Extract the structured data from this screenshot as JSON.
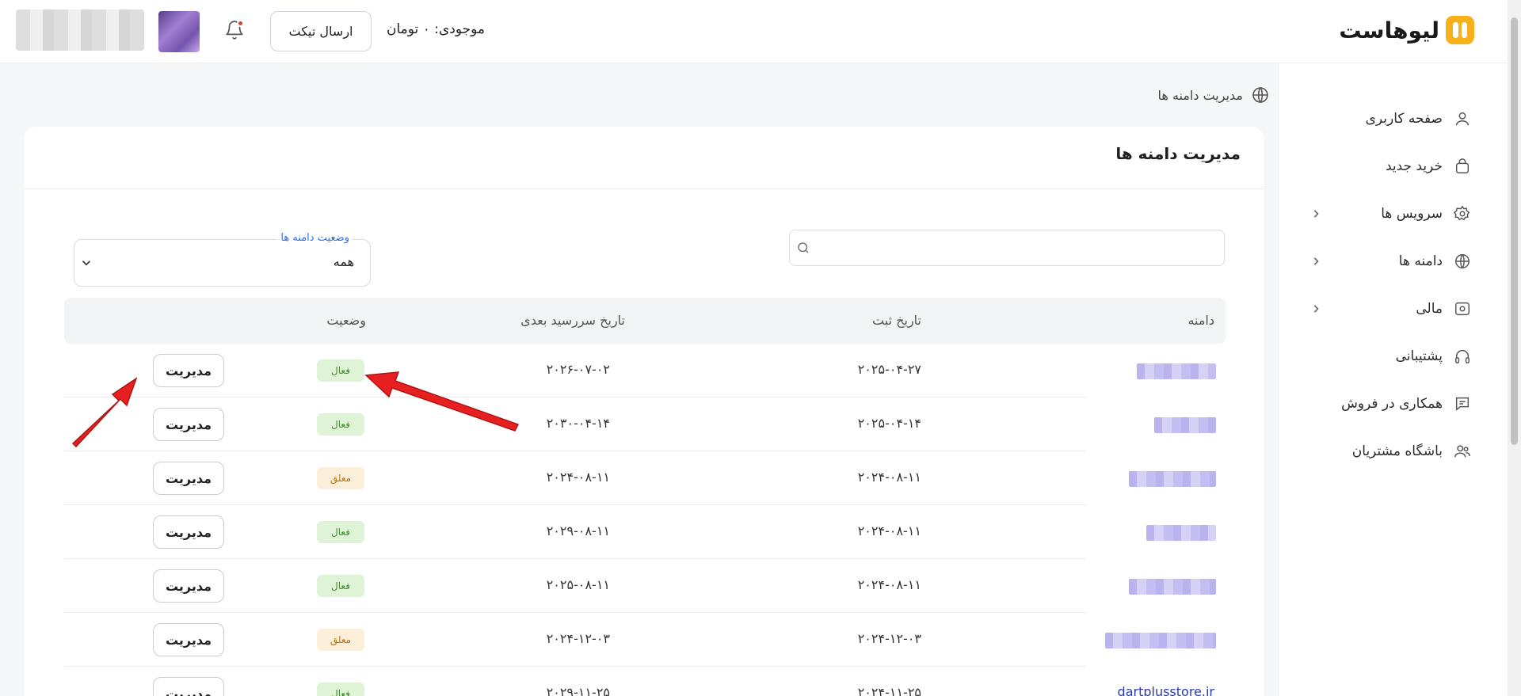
{
  "header": {
    "brand": "لیوهاست",
    "balance": "موجودی: ۰ تومان",
    "send_ticket": "ارسال تیکت"
  },
  "sidebar": {
    "items": [
      {
        "label": "صفحه کاربری",
        "icon": "user-icon"
      },
      {
        "label": "خرید جدید",
        "icon": "shopping-bag-icon"
      },
      {
        "label": "سرویس ها",
        "icon": "gear-icon"
      },
      {
        "label": "دامنه ها",
        "icon": "globe-icon"
      },
      {
        "label": "مالی",
        "icon": "money-icon"
      },
      {
        "label": "پشتیبانی",
        "icon": "headset-icon"
      },
      {
        "label": "همکاری در فروش",
        "icon": "chat-icon"
      },
      {
        "label": "باشگاه مشتریان",
        "icon": "users-icon"
      }
    ]
  },
  "breadcrumb": "مدیریت دامنه ها",
  "card": {
    "title": "مدیریت دامنه ها",
    "filter_label": "وضعیت دامنه ها",
    "filter_value": "همه"
  },
  "table": {
    "headers": {
      "domain": "دامنه",
      "reg_date": "تاریخ ثبت",
      "due_date": "تاریخ سررسید بعدی",
      "status": "وضعیت"
    },
    "manage_label": "مدیریت",
    "rows": [
      {
        "domain": "",
        "reg_date": "۲۰۲۵-۰۴-۲۷",
        "due_date": "۲۰۲۶-۰۷-۰۲",
        "status": "فعال",
        "status_type": "active"
      },
      {
        "domain": "",
        "reg_date": "۲۰۲۵-۰۴-۱۴",
        "due_date": "۲۰۳۰-۰۴-۱۴",
        "status": "فعال",
        "status_type": "active"
      },
      {
        "domain": "",
        "reg_date": "۲۰۲۴-۰۸-۱۱",
        "due_date": "۲۰۲۴-۰۸-۱۱",
        "status": "معلق",
        "status_type": "suspended"
      },
      {
        "domain": "",
        "reg_date": "۲۰۲۴-۰۸-۱۱",
        "due_date": "۲۰۲۹-۰۸-۱۱",
        "status": "فعال",
        "status_type": "active"
      },
      {
        "domain": "",
        "reg_date": "۲۰۲۴-۰۸-۱۱",
        "due_date": "۲۰۲۵-۰۸-۱۱",
        "status": "فعال",
        "status_type": "active"
      },
      {
        "domain": "",
        "reg_date": "۲۰۲۴-۱۲-۰۳",
        "due_date": "۲۰۲۴-۱۲-۰۳",
        "status": "معلق",
        "status_type": "suspended"
      },
      {
        "domain": "dartplusstore.ir",
        "reg_date": "۲۰۲۴-۱۱-۲۵",
        "due_date": "۲۰۲۹-۱۱-۲۵",
        "status": "فعال",
        "status_type": "active"
      }
    ]
  },
  "colors": {
    "accent": "#f7b21b",
    "active_bg": "#dff3d6",
    "suspended_bg": "#fcefd9",
    "arrow": "#e62020",
    "link": "#2a3bb0"
  }
}
